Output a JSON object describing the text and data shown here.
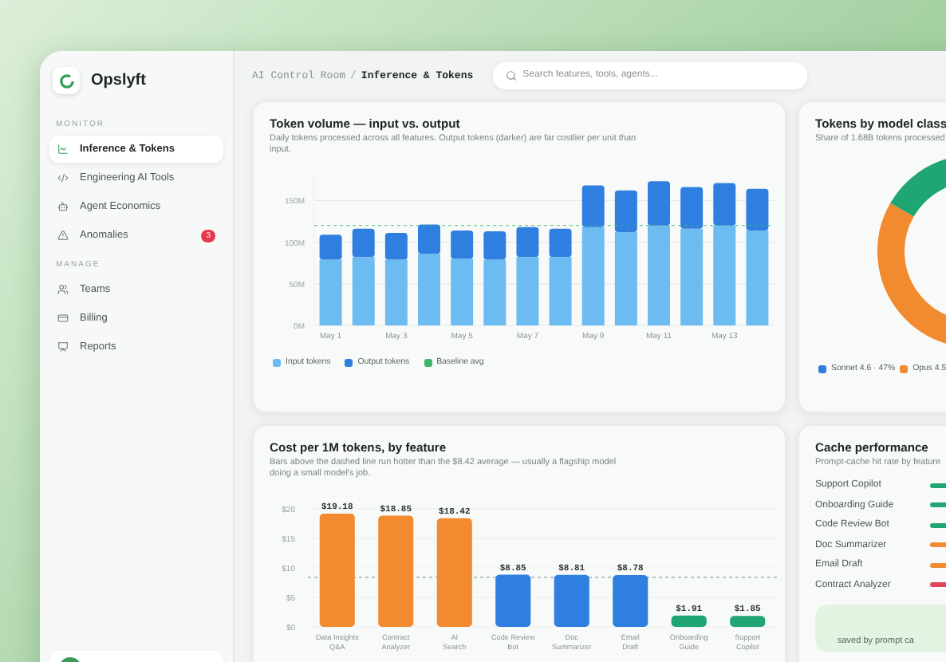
{
  "app": {
    "name": "Opslyft"
  },
  "sidebar": {
    "sections": [
      {
        "title": "MONITOR",
        "items": [
          {
            "label": "Inference & Tokens",
            "selected": true
          },
          {
            "label": "Engineering AI Tools",
            "selected": false
          },
          {
            "label": "Agent Economics",
            "selected": false
          },
          {
            "label": "Anomalies",
            "selected": false,
            "badge": "3"
          }
        ]
      },
      {
        "title": "MANAGE",
        "items": [
          {
            "label": "Teams",
            "selected": false
          },
          {
            "label": "Billing",
            "selected": false
          },
          {
            "label": "Reports",
            "selected": false
          }
        ]
      }
    ]
  },
  "header": {
    "breadcrumb": [
      "AI Control Room",
      "Inference & Tokens"
    ],
    "breadcrumb_separator": "/",
    "search": {
      "placeholder": "Search features, tools, agents..."
    }
  },
  "token_card": {
    "title": "Token volume — input vs. output",
    "subtitle": "Daily tokens processed across all features. Output tokens (darker) are far costlier per unit than input.",
    "chart_data": {
      "type": "bar",
      "stacked": true,
      "grid": true,
      "categories": [
        "May 1",
        null,
        "May 3",
        null,
        "May 5",
        null,
        "May 7",
        null,
        "May 9",
        null,
        "May 11",
        null,
        "May 13",
        null
      ],
      "series": [
        {
          "name": "Input tokens",
          "color": "#6cbcf2",
          "values": [
            79,
            82,
            79,
            86,
            80,
            79,
            82,
            82,
            118,
            112,
            120,
            116,
            120,
            114
          ]
        },
        {
          "name": "Output tokens",
          "color": "#2f7fe0",
          "values": [
            30,
            34,
            32,
            35,
            34,
            34,
            36,
            34,
            50,
            50,
            53,
            50,
            51,
            50
          ]
        }
      ],
      "ylim": [
        0,
        180
      ],
      "yticks": [
        {
          "value": 0,
          "label": "0M"
        },
        {
          "value": 50,
          "label": "50M"
        },
        {
          "value": 100,
          "label": "100M"
        },
        {
          "value": 150,
          "label": "150M"
        }
      ],
      "ref_lines": [
        {
          "axis": "y",
          "value": 120,
          "label": "Baseline avg",
          "color": "#3cb56a"
        }
      ]
    }
  },
  "model_card": {
    "title": "Tokens by model class",
    "subtitle": "Share of 1.68B tokens processed",
    "legend": [
      {
        "label": "Sonnet 4.6 · 47%",
        "color": "#2f7fe0"
      },
      {
        "label": "Opus 4.5",
        "color": "#f28a30"
      }
    ]
  },
  "cost_card": {
    "title": "Cost per 1M tokens, by feature",
    "subtitle": "Bars above the dashed line run hotter than the $8.42 average — usually a flagship model doing a small model's job.",
    "chart_data": {
      "type": "bar",
      "grid": true,
      "categories": [
        "Data Insights Q&A",
        "Contract Analyzer",
        "AI Search",
        "Code Review Bot",
        "Doc Summarizer",
        "Email Draft",
        "Onboarding Guide",
        "Support Copilot"
      ],
      "series": [
        {
          "values": [
            19.18,
            18.85,
            18.42,
            8.85,
            8.81,
            8.78,
            1.91,
            1.85
          ]
        }
      ],
      "value_labels": [
        "$19.18",
        "$18.85",
        "$18.42",
        "$8.85",
        "$8.81",
        "$8.78",
        "$1.91",
        "$1.85"
      ],
      "colors": [
        "#f28a30",
        "#f28a30",
        "#f28a30",
        "#2f7fe0",
        "#2f7fe0",
        "#2f7fe0",
        "#1fa672",
        "#1fa672"
      ],
      "ylim": [
        0,
        20
      ],
      "yticks": [
        {
          "value": 0,
          "label": "$0"
        },
        {
          "value": 5,
          "label": "$5"
        },
        {
          "value": 10,
          "label": "$10"
        },
        {
          "value": 15,
          "label": "$15"
        },
        {
          "value": 20,
          "label": "$20"
        }
      ],
      "ref_lines": [
        {
          "axis": "y",
          "value": 8.42
        }
      ]
    }
  },
  "cache_card": {
    "title": "Cache performance",
    "subtitle": "Prompt-cache hit rate by feature",
    "rows": [
      {
        "name": "Support Copilot",
        "color": "#1fa672"
      },
      {
        "name": "Onboarding Guide",
        "color": "#1fa672"
      },
      {
        "name": "Code Review Bot",
        "color": "#1fa672"
      },
      {
        "name": "Doc Summarizer",
        "color": "#f28a30"
      },
      {
        "name": "Email Draft",
        "color": "#f28a30"
      },
      {
        "name": "Contract Analyzer",
        "color": "#e0455a"
      }
    ],
    "savings_caption": "saved by prompt ca"
  }
}
